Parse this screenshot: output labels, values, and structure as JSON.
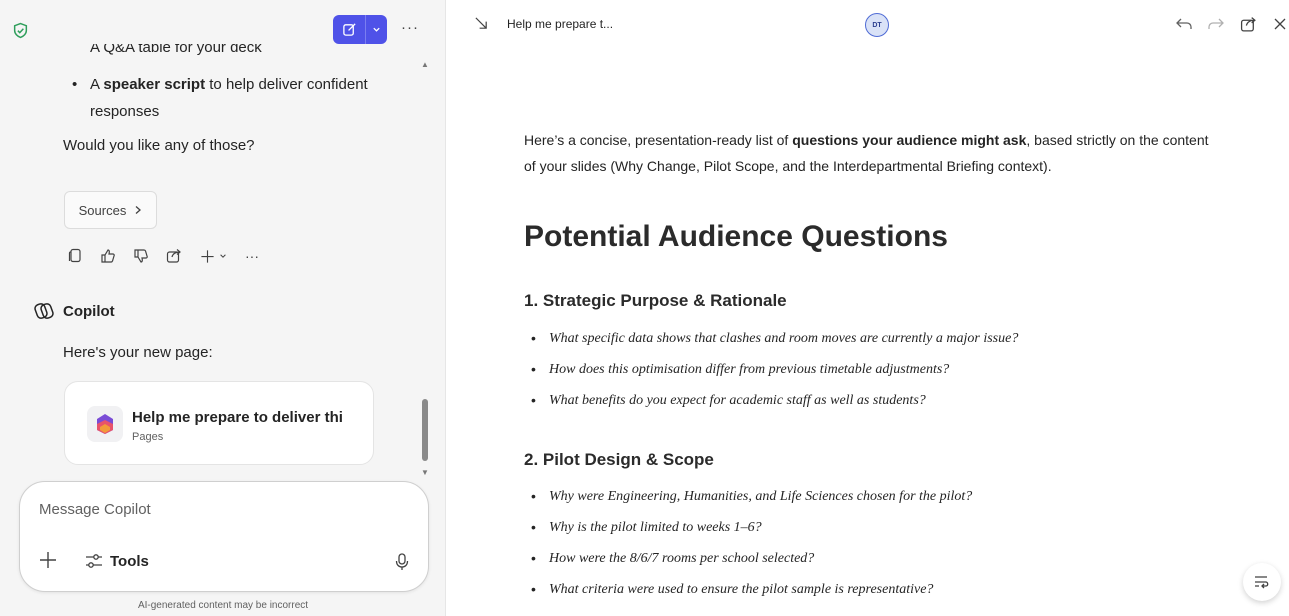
{
  "sidebar": {
    "shield_icon": "shield-check-icon",
    "cut_text": "A Q&A table for your deck",
    "bullet": {
      "bold": "speaker script",
      "pre": "A ",
      "post": " to help deliver confident responses"
    },
    "question": "Would you like any of those?",
    "sources_label": "Sources",
    "copilot_name": "Copilot",
    "new_page_text": "Here's your new page:",
    "page_card": {
      "title": "Help me prepare to deliver thi",
      "subtitle": "Pages"
    },
    "composer": {
      "placeholder": "Message Copilot",
      "tools_label": "Tools"
    },
    "disclaimer": "AI-generated content may be incorrect"
  },
  "topbar": {
    "doc_title": "Help me prepare t...",
    "avatar_initials": "DT"
  },
  "content": {
    "intro_pre": "Here’s a concise, presentation-ready list of ",
    "intro_bold": "questions your audience might ask",
    "intro_post": ", based strictly on the content of your slides (Why Change, Pilot Scope, and the Interdepartmental Briefing context).",
    "heading": "Potential Audience Questions",
    "sections": [
      {
        "title": "1. Strategic Purpose & Rationale",
        "questions": [
          "What specific data shows that clashes and room moves are currently a major issue?",
          "How does this optimisation differ from previous timetable adjustments?",
          "What benefits do you expect for academic staff as well as students?"
        ]
      },
      {
        "title": "2. Pilot Design & Scope",
        "questions": [
          "Why were Engineering, Humanities, and Life Sciences chosen for the pilot?",
          "Why is the pilot limited to weeks 1–6?",
          "How were the 8/6/7 rooms per school selected?",
          "What criteria were used to ensure the pilot sample is representative?"
        ]
      }
    ]
  },
  "colors": {
    "accent": "#4f52e8",
    "sidebar_bg": "#f5f5f5",
    "shield": "#2e9e5b"
  }
}
